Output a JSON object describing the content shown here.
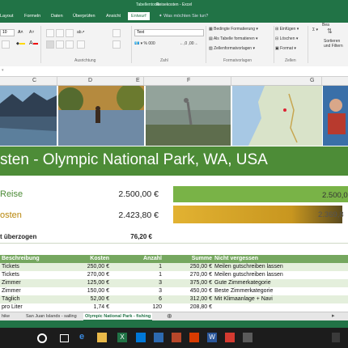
{
  "window": {
    "context_tab": "Tabellentools",
    "document_title": "Reisekosten - Excel"
  },
  "ribbon_tabs": [
    "Layout",
    "Formeln",
    "Daten",
    "Überprüfen",
    "Ansicht",
    "Entwurf"
  ],
  "tell_me": "Was möchten Sie tun?",
  "ribbon": {
    "font_size": "10",
    "number_format": "Text",
    "styles": {
      "conditional": "Bedingte Formatierung",
      "as_table": "Als Tabelle formatieren",
      "cell_styles": "Zellenformatvorlagen"
    },
    "cells": {
      "insert": "Einfügen",
      "delete": "Löschen",
      "format": "Format"
    },
    "edit": {
      "sort_filter": "Sortieren und Filtern",
      "edit_label": "Bea"
    },
    "groups": {
      "alignment": "Ausrichtung",
      "number": "Zahl",
      "styles": "Formatvorlagen",
      "cells": "Zellen"
    }
  },
  "columns": [
    "C",
    "D",
    "E",
    "F",
    "G"
  ],
  "banner_title": "sten - Olympic National Park, WA, USA",
  "budget": {
    "reise_label": "Reise",
    "reise_value": "2.500,00 €",
    "reise_bar_value": "2.500,0",
    "kosten_label": "osten",
    "kosten_value": "2.423,80 €",
    "kosten_bar_value": "2.369,8",
    "kosten_bar_fraction": 0.969,
    "over_label": "t überzogen",
    "over_value": "76,20 €"
  },
  "table": {
    "headers": [
      "Beschreibung",
      "Kosten",
      "Anzahl",
      "Summe",
      "Nicht vergessen"
    ],
    "rows": [
      [
        "Tickets",
        "250,00 €",
        "1",
        "250,00 €",
        "Meilen gutschreiben lassen"
      ],
      [
        "Tickets",
        "270,00 €",
        "1",
        "270,00 €",
        "Meilen gutschreiben lassen"
      ],
      [
        "Zimmer",
        "125,00 €",
        "3",
        "375,00 €",
        "Gute Zimmerkategorie"
      ],
      [
        "Zimmer",
        "150,00 €",
        "3",
        "450,00 €",
        "Beste Zimmerkategorie"
      ],
      [
        "Täglich",
        "52,00 €",
        "6",
        "312,00 €",
        "Mit Klimaanlage + Navi"
      ],
      [
        "pro Liter",
        "1,74 €",
        "120",
        "208,80 €",
        ""
      ]
    ]
  },
  "sheet_tabs": [
    "hike",
    "San Juan Islands - sailing",
    "Olympic National Park - fishing"
  ],
  "colors": {
    "excel_green": "#217346",
    "banner_green": "#4d8c37",
    "table_header": "#75a75f",
    "row_alt": "#e4efdc",
    "budget_bar": "#79b347",
    "cost_bar": "#d9a528"
  }
}
